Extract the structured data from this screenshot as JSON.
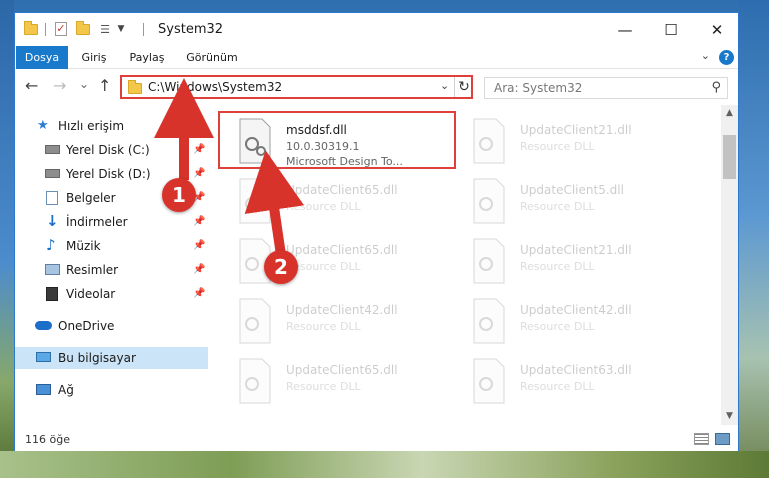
{
  "window": {
    "title": "System32",
    "controls": {
      "minimize": "—",
      "maximize": "☐",
      "close": "✕"
    }
  },
  "ribbon": {
    "tabs": [
      "Dosya",
      "Giriş",
      "Paylaş",
      "Görünüm"
    ],
    "help": "?"
  },
  "navbar": {
    "back": "←",
    "forward": "→",
    "recent": "⌄",
    "up": "↑",
    "address": "C:\\Windows\\System32",
    "search_placeholder": "Ara: System32"
  },
  "navpane": {
    "items": [
      {
        "label": "Hızlı erişim",
        "icon": "star-icon",
        "pinned": false
      },
      {
        "label": "Yerel Disk (C:)",
        "icon": "drive-icon",
        "pinned": true
      },
      {
        "label": "Yerel Disk (D:)",
        "icon": "drive-icon",
        "pinned": true
      },
      {
        "label": "Belgeler",
        "icon": "documents-icon",
        "pinned": true
      },
      {
        "label": "İndirmeler",
        "icon": "downloads-icon",
        "pinned": true
      },
      {
        "label": "Müzik",
        "icon": "music-icon",
        "pinned": true
      },
      {
        "label": "Resimler",
        "icon": "pictures-icon",
        "pinned": true
      },
      {
        "label": "Videolar",
        "icon": "videos-icon",
        "pinned": true
      },
      {
        "label": "OneDrive",
        "icon": "cloud-icon",
        "pinned": false
      },
      {
        "label": "Bu bilgisayar",
        "icon": "computer-icon",
        "pinned": false
      },
      {
        "label": "Ağ",
        "icon": "network-icon",
        "pinned": false
      }
    ]
  },
  "files": [
    {
      "name": "msddsf.dll",
      "line2": "10.0.30319.1",
      "line3": "Microsoft Design To...",
      "faded": false
    },
    {
      "name": "UpdateClient21.dll",
      "line2": "Resource DLL",
      "faded": true
    },
    {
      "name": "UpdateClient65.dll",
      "line2": "Resource DLL",
      "faded": true
    },
    {
      "name": "UpdateClient5.dll",
      "line2": "Resource DLL",
      "faded": true
    },
    {
      "name": "UpdateClient65.dll",
      "line2": "Resource DLL",
      "faded": true
    },
    {
      "name": "UpdateClient21.dll",
      "line2": "Resource DLL",
      "faded": true
    },
    {
      "name": "UpdateClient42.dll",
      "line2": "Resource DLL",
      "faded": true
    },
    {
      "name": "UpdateClient42.dll",
      "line2": "Resource DLL",
      "faded": true
    },
    {
      "name": "UpdateClient65.dll",
      "line2": "Resource DLL",
      "faded": true
    },
    {
      "name": "UpdateClient63.dll",
      "line2": "Resource DLL",
      "faded": true
    }
  ],
  "status": {
    "count": "116 öğe"
  },
  "annotations": {
    "step1": "1",
    "step2": "2",
    "color": "#d8332a"
  }
}
